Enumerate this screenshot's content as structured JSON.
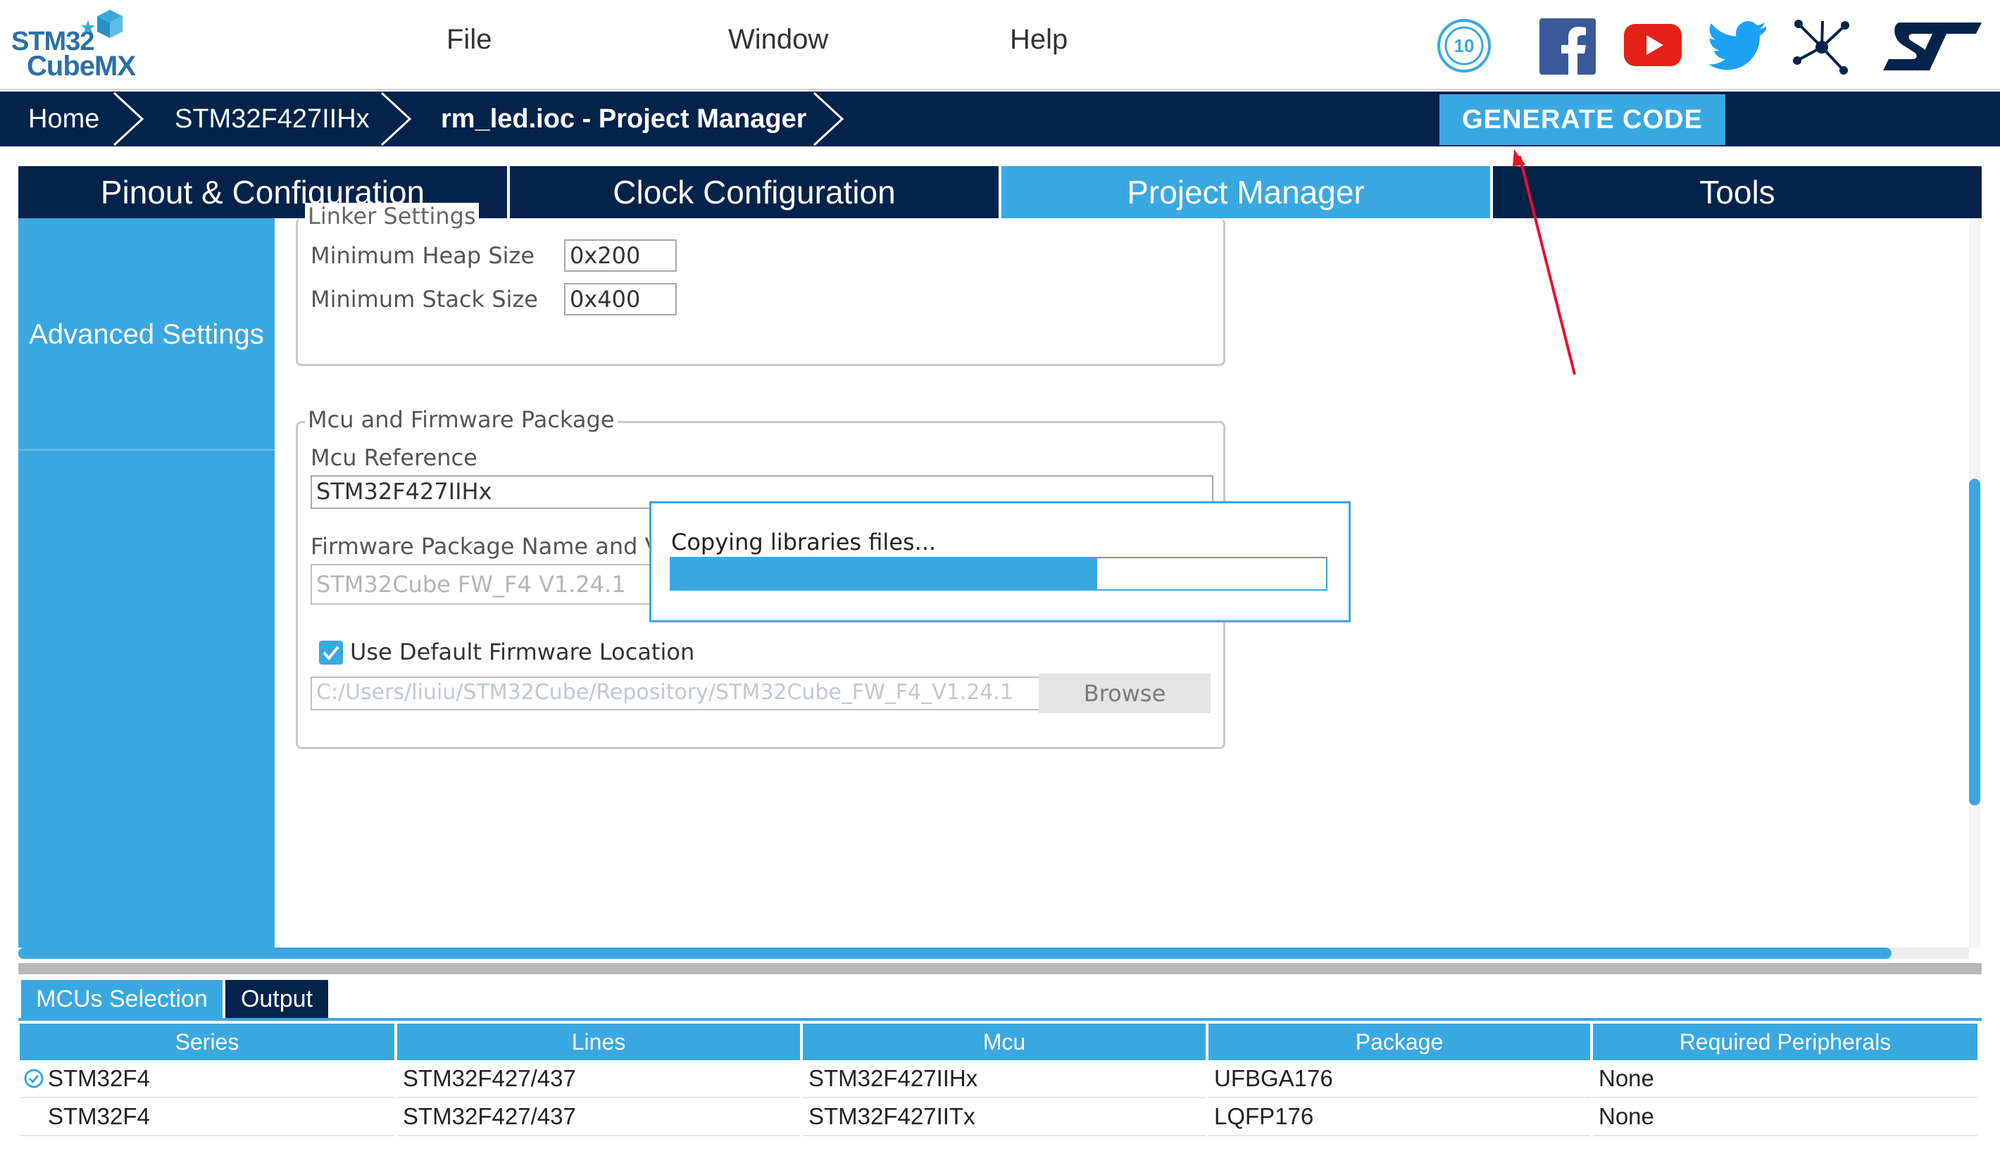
{
  "app": {
    "logo_line1": "STM32",
    "logo_line2": "CubeMX"
  },
  "menu": {
    "file": "File",
    "window": "Window",
    "help": "Help"
  },
  "social_icons": [
    "anniversary-badge-icon",
    "facebook-icon",
    "youtube-icon",
    "twitter-icon",
    "network-icon",
    "st-logo-icon"
  ],
  "breadcrumb": {
    "home": "Home",
    "mcu": "STM32F427IIHx",
    "project": "rm_led.ioc - Project Manager"
  },
  "generate_button": "GENERATE CODE",
  "tabs": {
    "pinout": "Pinout & Configuration",
    "clock": "Clock Configuration",
    "project": "Project Manager",
    "tools": "Tools"
  },
  "sidebar": {
    "advanced": "Advanced Settings"
  },
  "linker": {
    "legend": "Linker Settings",
    "heap_label": "Minimum Heap Size",
    "heap_value": "0x200",
    "stack_label": "Minimum Stack Size",
    "stack_value": "0x400"
  },
  "mcu_fw": {
    "legend": "Mcu and Firmware Package",
    "mcu_ref_label": "Mcu Reference",
    "mcu_ref_value": "STM32F427IIHx",
    "fw_label": "Firmware Package Name and Version",
    "fw_value": "STM32Cube FW_F4 V1.24.1",
    "default_loc_label": "Use Default Firmware Location",
    "default_loc_checked": true,
    "path_value": "C:/Users/liuiu/STM32Cube/Repository/STM32Cube_FW_F4_V1.24.1",
    "browse": "Browse"
  },
  "dialog": {
    "message": "Copying libraries files...",
    "progress": 0.65
  },
  "bottom_tabs": {
    "mcus": "MCUs Selection",
    "output": "Output"
  },
  "table": {
    "headers": [
      "Series",
      "Lines",
      "Mcu",
      "Package",
      "Required Peripherals"
    ],
    "rows": [
      [
        "STM32F4",
        "STM32F427/437",
        "STM32F427IIHx",
        "UFBGA176",
        "None"
      ],
      [
        "STM32F4",
        "STM32F427/437",
        "STM32F427IITx",
        "LQFP176",
        "None"
      ]
    ]
  },
  "colors": {
    "navy": "#03234b",
    "accent": "#3aa8e0",
    "annotation": "#e8112d"
  }
}
